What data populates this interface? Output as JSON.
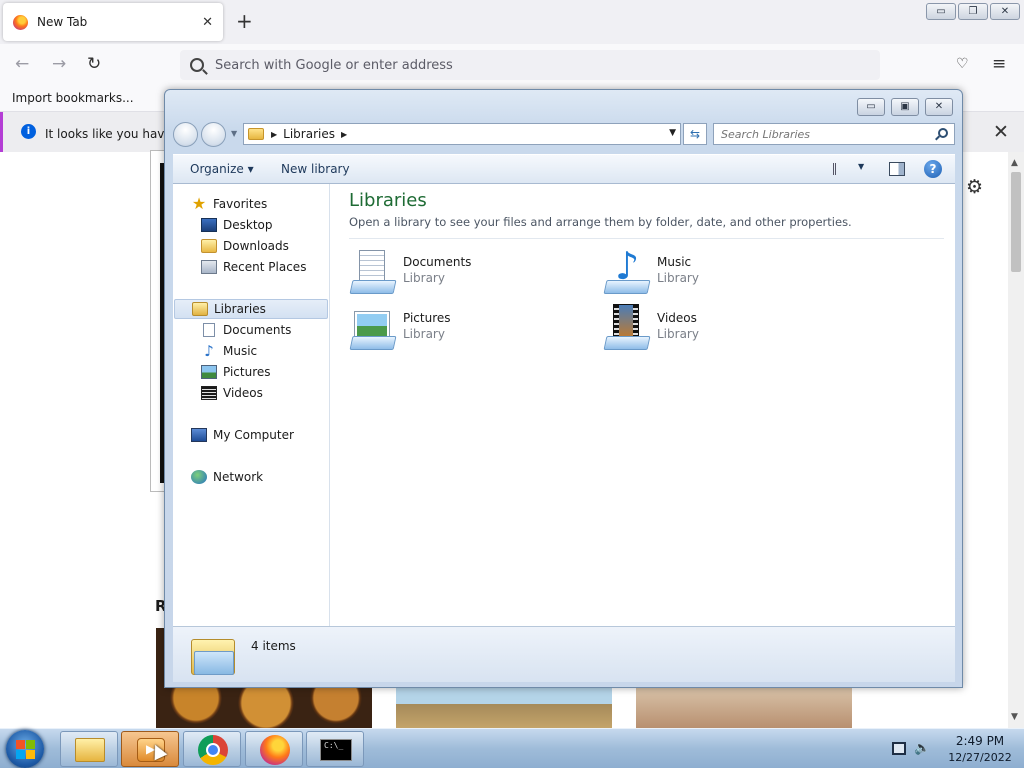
{
  "browser": {
    "tab_title": "New Tab",
    "tab_close": "✕",
    "new_tab": "+",
    "url_placeholder": "Search with Google or enter address",
    "bookmark_import": "Import bookmarks...",
    "notification_text": "It looks like you haven't",
    "window_controls": [
      "▭",
      "❐",
      "✕"
    ],
    "icons": [
      "back-arrow-icon",
      "forward-arrow-icon",
      "reload-icon",
      "pocket-icon",
      "menu-icon",
      "gear-icon",
      "info-icon"
    ],
    "recommended_heading": "R"
  },
  "explorer": {
    "window_controls": [
      "▭",
      "▣",
      "✕"
    ],
    "address": {
      "crumb": "Libraries"
    },
    "search_placeholder": "Search Libraries",
    "toolbar": {
      "organize": "Organize ▾",
      "new_library": "New library",
      "help": "?"
    },
    "nav_pane": {
      "favorites": "Favorites",
      "desktop": "Desktop",
      "downloads": "Downloads",
      "recent_places": "Recent Places",
      "libraries": "Libraries",
      "documents": "Documents",
      "music": "Music",
      "pictures": "Pictures",
      "videos": "Videos",
      "my_computer": "My Computer",
      "network": "Network"
    },
    "content": {
      "title": "Libraries",
      "subtitle": "Open a library to see your files and arrange them by folder, date, and other properties.",
      "libraries": [
        {
          "name": "Documents",
          "kind": "Library"
        },
        {
          "name": "Music",
          "kind": "Library"
        },
        {
          "name": "Pictures",
          "kind": "Library"
        },
        {
          "name": "Videos",
          "kind": "Library"
        }
      ]
    },
    "status": {
      "count": "4 items"
    }
  },
  "taskbar": {
    "clock_time": "2:49 PM",
    "clock_date": "12/27/2022",
    "cmd_prompt": "C:\\_"
  },
  "colors": {
    "library_title": "#1e6b34",
    "accent_blue": "#0060df"
  }
}
